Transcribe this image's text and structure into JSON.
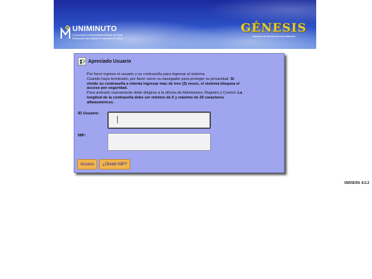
{
  "header": {
    "logo_left_name": "UNIMINUTO",
    "logo_left_line1": "Corporación Universitaria Minuto de Dios",
    "logo_left_line2": "Educación de calidad al alcance de todos",
    "logo_right_name": "GÉNESIS",
    "logo_right_sub": "Sistema de Información Académica"
  },
  "panel": {
    "title": "Apreciado Usuario",
    "msg_1": "Por favor ingrese el usuario y su contraseña para ingresar al sistema.",
    "msg_2": "Cuando haya terminado, por favor cierre su navegador para proteger su privacidad.",
    "msg_3_bold": "Si olvido su contraseña e intenta ingresar mas de tres (3) veces, el sistema bloquea el acceso por seguridad.",
    "msg_4": "Para activarlo nuevamente debe dirigirse a la oficina de Admisiones, Registro y Control.",
    "msg_5_bold": "La longitud de la contraseña debe ser mínimo de 6 y máximo de 20 caracteres alfanuméricos."
  },
  "form": {
    "user_label": "ID Usuario:",
    "user_value": "",
    "pin_label": "NIP:",
    "pin_value": ""
  },
  "buttons": {
    "login": "Acceso",
    "forgot": "¿Olvidó NIP?"
  },
  "version": "VERSION: 8.5.2"
}
